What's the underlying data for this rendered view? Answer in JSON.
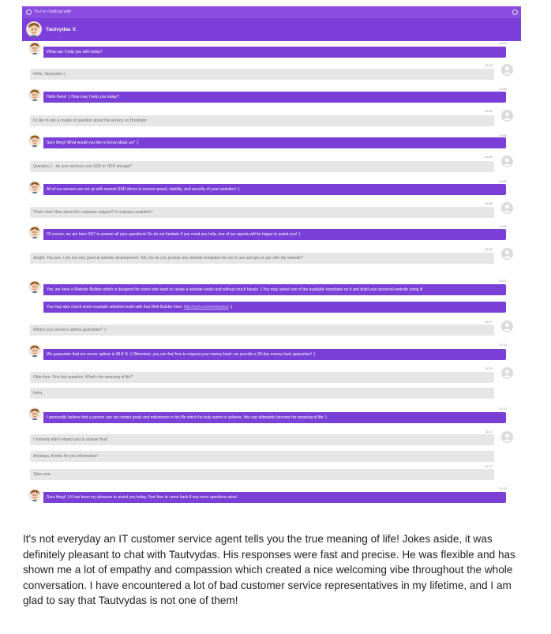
{
  "header": {
    "status": "You're chatting with",
    "agent_name": "Tautvydas V."
  },
  "icons": {
    "agent_avatar": "agent-avatar",
    "user_avatar": "user-avatar-placeholder"
  },
  "colors": {
    "agent_bubble": "#7a3fd6",
    "header": "#8a4de0",
    "user_bubble": "#e6e6e6"
  },
  "messages": [
    {
      "text": "What can I help you with today?",
      "time": "11:00"
    },
    {
      "text": "Hello, Tautvydas :)",
      "time": "11:03"
    },
    {
      "text": "Hello there! :) How may I help you today?",
      "time": "11:05"
    },
    {
      "text": "I'd like to ask a couple of question about the service on Hostinger",
      "time": "11:03"
    },
    {
      "text": "Sure thing! What would you like to know about us? :)",
      "time": "11:05"
    },
    {
      "text": "Question 1 - do your services use SSD or HDD storage?",
      "time": "11:05"
    },
    {
      "text": "All of our servers are set up with newest SSD drives to ensure speed, stability, and security of your websites! :)",
      "time": "11:05"
    },
    {
      "text": "That's nice! How about the customer support? Is it always available?",
      "time": "11:05"
    },
    {
      "text": "Of course, we are here 24/7 to answer all your questions! So do not hesitate if you need any help, one of our agents will be happy to assist you! :)",
      "time": "11:05"
    },
    {
      "text": "Alright. You see, I am not very good at website development. Tell, me do you provide any website templates for me to use and get on par with the website?",
      "time": "11:05"
    },
    {
      "text": "Yes, we have a Website Builder which is designed for users who want to create a website easily and without much hassle :) You may select one of the available templates on it and build your personal website using it!",
      "time": "11:07"
    },
    {
      "text": "You may also check some example websites build with that Web Builder here:",
      "link": "http://zyro.com/examples/",
      "suffix": ":)"
    },
    {
      "text": "What's your server's uptime guarantee? :)",
      "time": "11:07"
    },
    {
      "text": "We guarantee that our server uptime is 99.9 % :) Otherwise, you can feel free to request your money back, we provide a 30-day money back guarantee! :)",
      "time": "11:10"
    },
    {
      "text": "Okie then. One last question: What's the meaning of life?",
      "time": "11:10"
    },
    {
      "text": "haha"
    },
    {
      "text": "I personally believe that a person can set certain goals and milestones in his life which he truly wants to achieve, this can ultimately become his meaning of life :)",
      "time": "11:12"
    },
    {
      "text": "I honestly didn't expect you to answer that!",
      "time": "11:12"
    },
    {
      "text": "Anyways, thanks for you information!"
    },
    {
      "text": "Take care",
      "time": "11:13"
    },
    {
      "text": "Sure thing! :) It has been my pleasure to assist you today. Feel free to come back if any more questions arise!",
      "time": "11:13"
    }
  ],
  "caption": "It's not everyday an IT customer service agent tells you the true meaning of life! Jokes aside, it was definitely pleasant to chat with Tautvydas. His responses were fast and precise. He was flexible and has shown me a lot of empathy and compassion which created a nice welcoming vibe throughout the whole conversation. I have encountered a lot of bad customer service representatives in my lifetime, and I am glad to say that Tautvydas is not one of them!"
}
